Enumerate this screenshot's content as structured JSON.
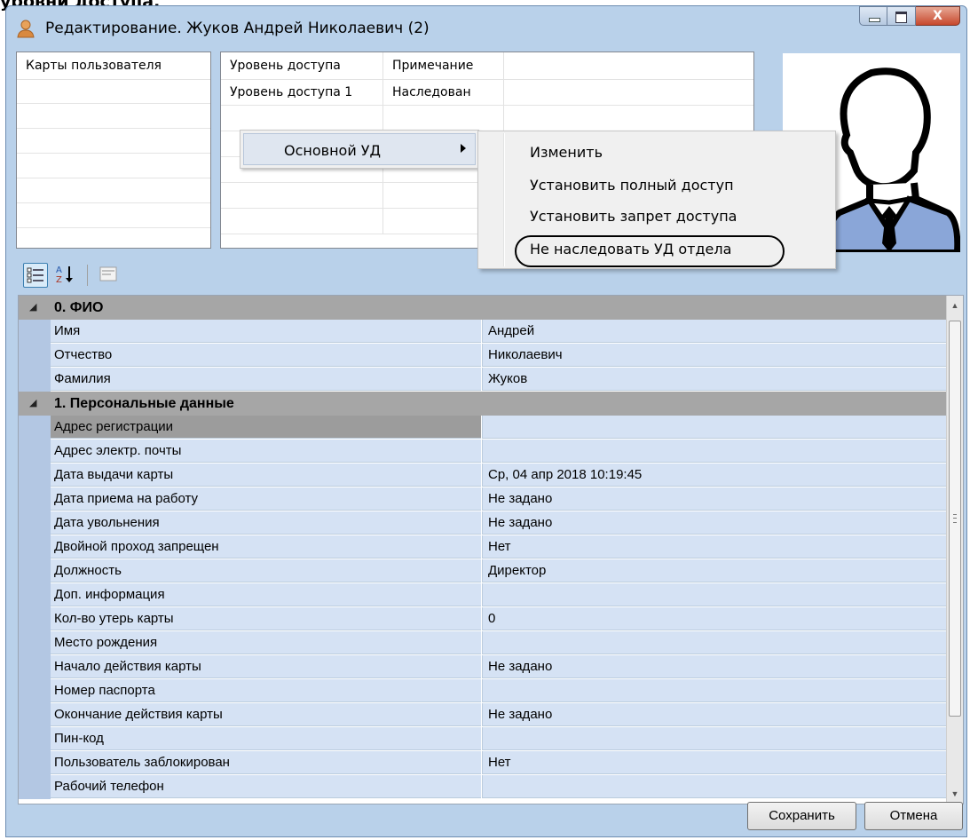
{
  "top_caption": "уровни доступа.",
  "window": {
    "title": "Редактирование. Жуков Андрей Николаевич (2)",
    "controls": [
      "minimize-icon",
      "maximize-icon",
      "close-icon"
    ]
  },
  "cards_panel": {
    "header": "Карты пользователя"
  },
  "access_panel": {
    "columns": [
      "Уровень доступа",
      "Примечание"
    ],
    "rows": [
      {
        "level": "Уровень доступа 1",
        "note": "Наследован"
      }
    ]
  },
  "context_menu": {
    "item": "Основной УД",
    "submenu": [
      "Изменить",
      "Установить полный доступ",
      "Установить запрет доступа",
      "Не наследовать УД отдела"
    ],
    "highlighted": "Не наследовать УД отдела"
  },
  "toolbar": {
    "icons": [
      "categorized-view-icon",
      "sort-alphabetical-icon",
      "property-pages-icon"
    ]
  },
  "properties": {
    "categories": [
      {
        "title": "0. ФИО",
        "rows": [
          {
            "name": "Имя",
            "value": "Андрей"
          },
          {
            "name": "Отчество",
            "value": "Николаевич"
          },
          {
            "name": "Фамилия",
            "value": "Жуков"
          }
        ]
      },
      {
        "title": "1. Персональные данные",
        "rows": [
          {
            "name": "Адрес регистрации",
            "value": "",
            "selected": true
          },
          {
            "name": "Адрес электр. почты",
            "value": ""
          },
          {
            "name": "Дата выдачи карты",
            "value": "Ср, 04 апр 2018 10:19:45"
          },
          {
            "name": "Дата приема на работу",
            "value": "Не задано"
          },
          {
            "name": "Дата увольнения",
            "value": "Не задано"
          },
          {
            "name": "Двойной проход запрещен",
            "value": "Нет"
          },
          {
            "name": "Должность",
            "value": "Директор"
          },
          {
            "name": "Доп. информация",
            "value": ""
          },
          {
            "name": "Кол-во утерь карты",
            "value": "0"
          },
          {
            "name": "Место рождения",
            "value": ""
          },
          {
            "name": "Начало действия карты",
            "value": "Не задано"
          },
          {
            "name": "Номер паспорта",
            "value": ""
          },
          {
            "name": "Окончание действия карты",
            "value": "Не задано"
          },
          {
            "name": "Пин-код",
            "value": ""
          },
          {
            "name": "Пользователь заблокирован",
            "value": "Нет"
          },
          {
            "name": "Рабочий телефон",
            "value": ""
          }
        ]
      }
    ]
  },
  "buttons": {
    "save": "Сохранить",
    "cancel": "Отмена"
  },
  "colors": {
    "window_frame": "#b9d1ea",
    "category_row": "#a6a6a6",
    "property_row": "#d5e2f4",
    "avatar_shirt": "#8aa6d8"
  }
}
